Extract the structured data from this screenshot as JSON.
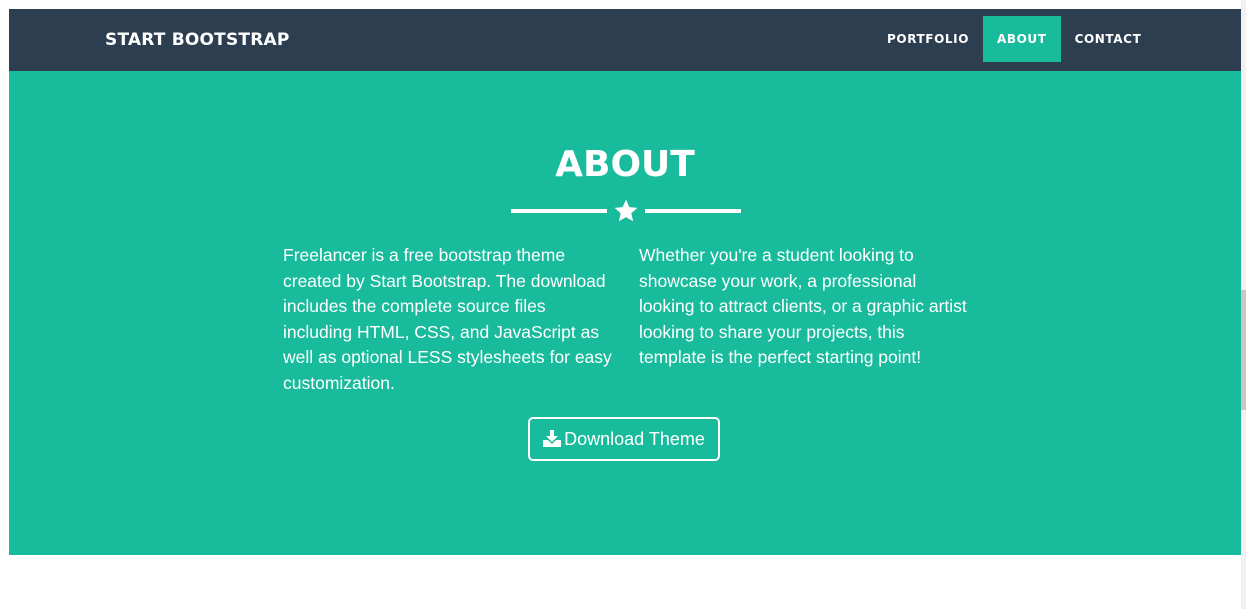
{
  "navbar": {
    "brand": "START BOOTSTRAP",
    "links": [
      {
        "label": "PORTFOLIO",
        "active": false
      },
      {
        "label": "ABOUT",
        "active": true
      },
      {
        "label": "CONTACT",
        "active": false
      }
    ]
  },
  "about": {
    "title": "ABOUT",
    "divider_icon": "star-icon",
    "left_text": "Freelancer is a free bootstrap theme created by Start Bootstrap. The download includes the complete source files including HTML, CSS, and JavaScript as well as optional LESS stylesheets for easy customization.",
    "right_text": "Whether you're a student looking to showcase your work, a professional looking to attract clients, or a graphic artist looking to share your projects, this template is the perfect starting point!",
    "button": {
      "icon": "download-icon",
      "label": "Download Theme"
    }
  },
  "colors": {
    "navbar_background": "#2c3e50",
    "accent": "#18bc9c",
    "text": "#ffffff"
  }
}
